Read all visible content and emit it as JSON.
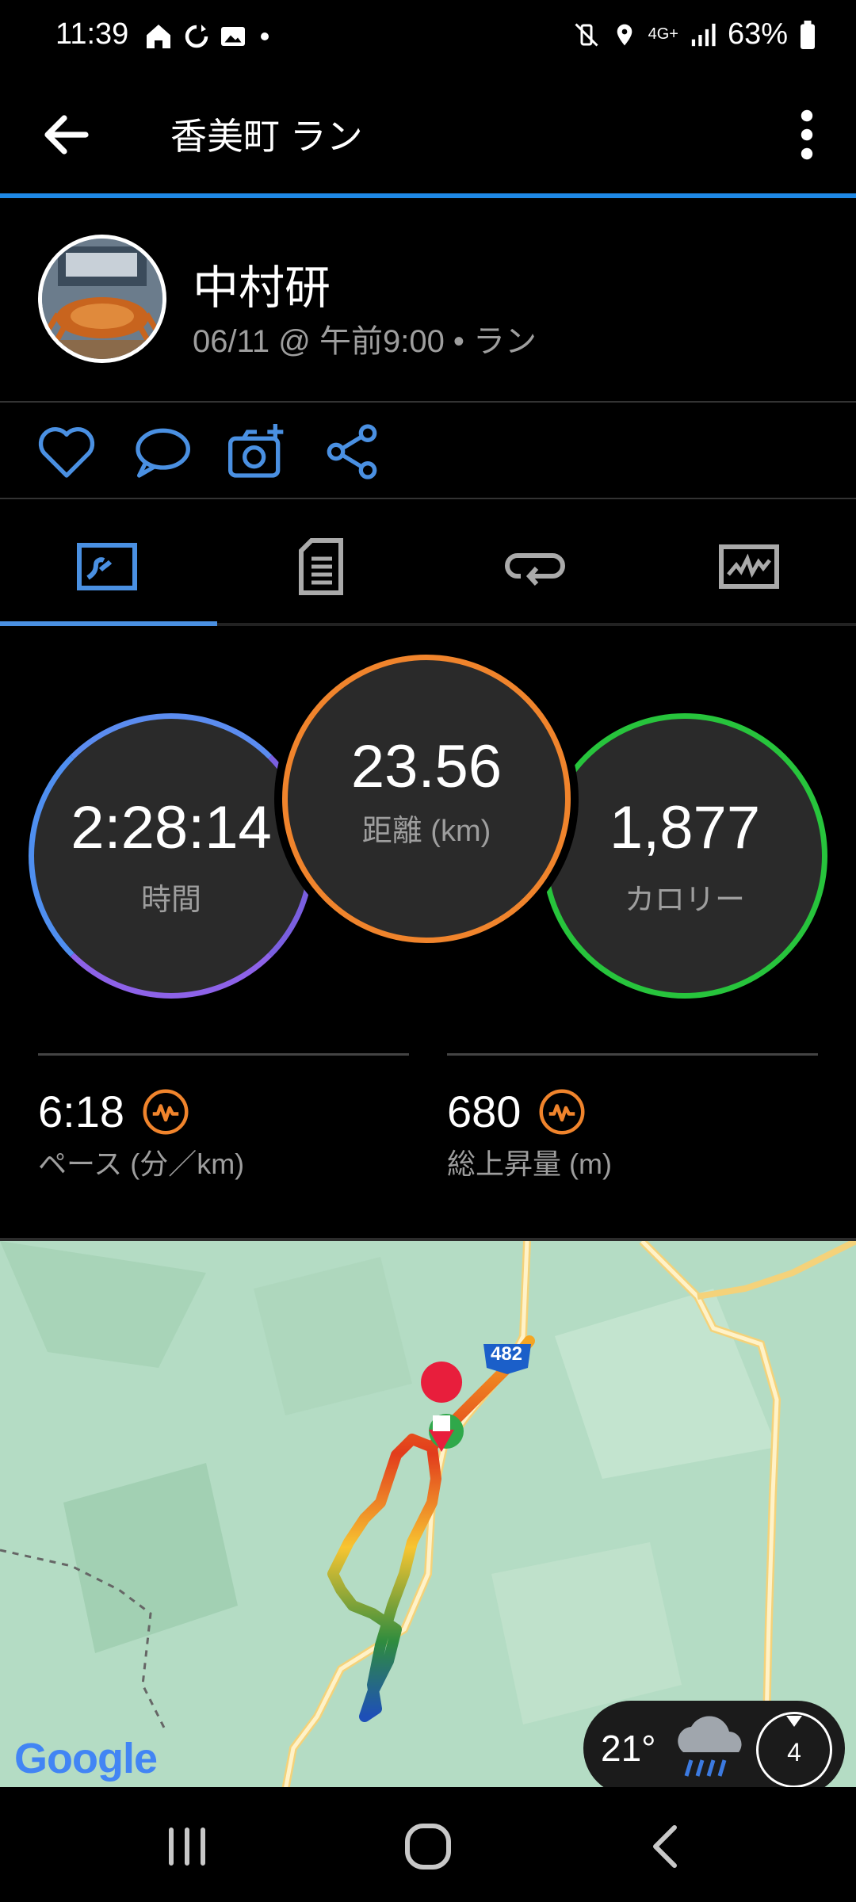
{
  "status_bar": {
    "time": "11:39",
    "battery": "63%",
    "network": "4G+"
  },
  "app_bar": {
    "title": "香美町 ラン"
  },
  "profile": {
    "name": "中村研",
    "meta": "06/11 @ 午前9:00 • ラン"
  },
  "actions": [
    "heart-icon",
    "comment-icon",
    "camera-add-icon",
    "share-icon"
  ],
  "tabs": [
    {
      "icon": "map-summary-icon",
      "active": true
    },
    {
      "icon": "details-icon",
      "active": false
    },
    {
      "icon": "laps-icon",
      "active": false
    },
    {
      "icon": "chart-icon",
      "active": false
    }
  ],
  "stats": {
    "time": {
      "value": "2:28:14",
      "label": "時間",
      "color": "#6e7cf0"
    },
    "distance": {
      "value": "23.56",
      "label": "距離 (km)",
      "color": "#f0842c"
    },
    "calories": {
      "value": "1,877",
      "label": "カロリー",
      "color": "#27c43c"
    },
    "pace": {
      "value": "6:18",
      "label": "ペース (分／km)"
    },
    "elevation": {
      "value": "680",
      "label": "総上昇量 (m)"
    }
  },
  "map": {
    "road_label": "482",
    "brand": "Google"
  },
  "weather": {
    "temp": "21°",
    "badge": "4"
  },
  "colors": {
    "accent": "#1e88e5",
    "highlight_orange": "#f0842c"
  }
}
